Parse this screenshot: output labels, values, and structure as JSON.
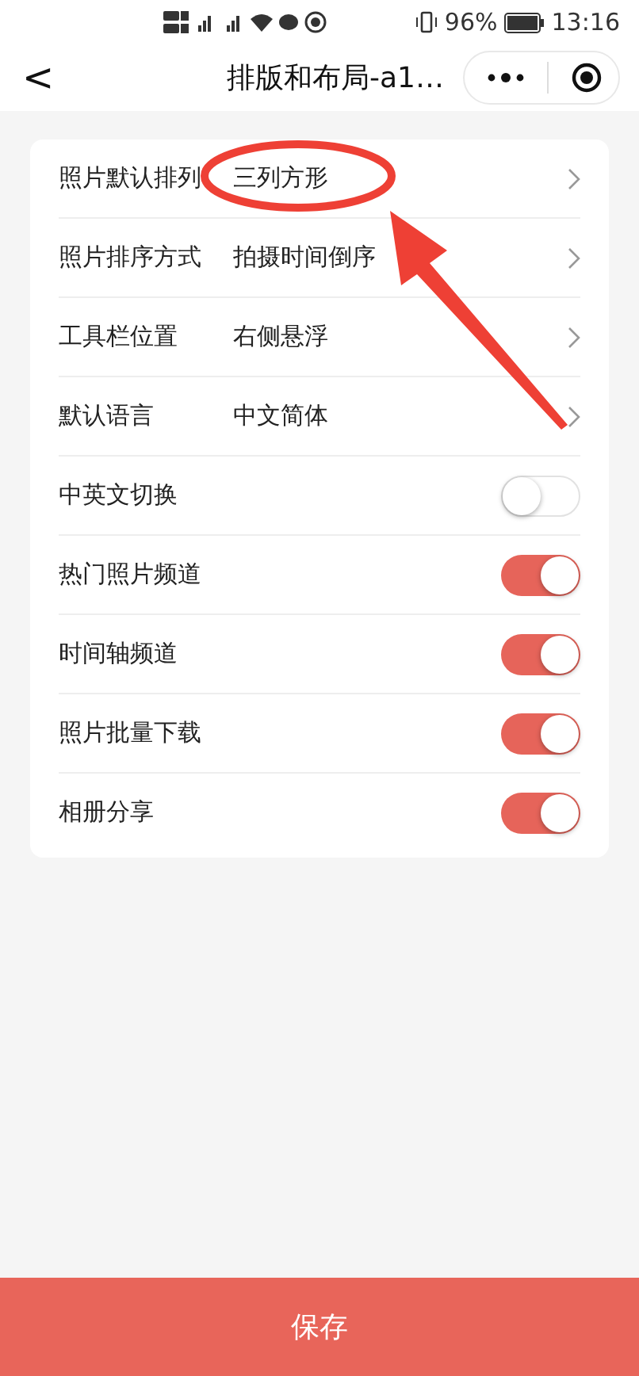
{
  "status_bar": {
    "battery": "96%",
    "time": "13:16"
  },
  "nav": {
    "back": "<",
    "title": "排版和布局-a1…"
  },
  "settings": [
    {
      "kind": "select",
      "label": "照片默认排列",
      "value": "三列方形"
    },
    {
      "kind": "select",
      "label": "照片排序方式",
      "value": "拍摄时间倒序"
    },
    {
      "kind": "select",
      "label": "工具栏位置",
      "value": "右侧悬浮"
    },
    {
      "kind": "select",
      "label": "默认语言",
      "value": "中文简体"
    },
    {
      "kind": "switch",
      "label": "中英文切换",
      "on": false
    },
    {
      "kind": "switch",
      "label": "热门照片频道",
      "on": true
    },
    {
      "kind": "switch",
      "label": "时间轴频道",
      "on": true
    },
    {
      "kind": "switch",
      "label": "照片批量下载",
      "on": true
    },
    {
      "kind": "switch",
      "label": "相册分享",
      "on": true
    }
  ],
  "save_button": "保存"
}
